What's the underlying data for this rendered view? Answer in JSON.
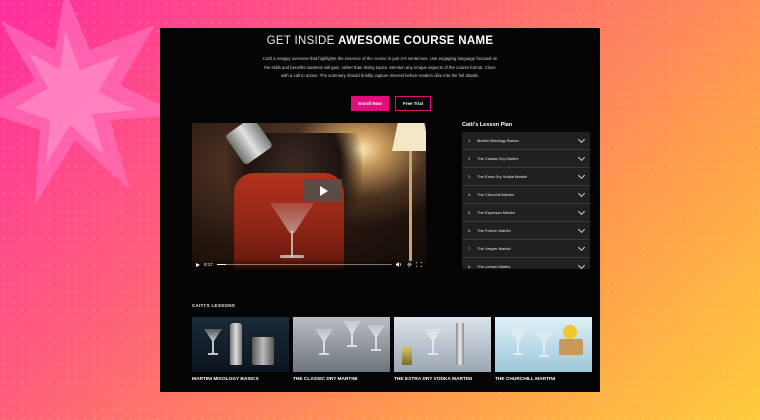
{
  "hero": {
    "title_prefix": "GET INSIDE",
    "title_strong": "AWESOME COURSE NAME",
    "description": "Craft a snappy overview that highlights the essence of the course in just 3-5 sentences. Use engaging language focused on the skills and benefits students will gain, rather than listing topics. Mention any unique aspects of the course format. Close with a call to action. The summary should briskly capture interest before readers dive into the full details.",
    "enroll_label": "Enroll Now",
    "trial_label": "Free Trial"
  },
  "video": {
    "timestamp": "0:17",
    "progress": 0.05
  },
  "lesson_plan": {
    "title": "Caiti's Lesson Plan",
    "items": [
      {
        "num": "1.",
        "name": "Martini Mixology Basics"
      },
      {
        "num": "2.",
        "name": "The Classic Dry Martini"
      },
      {
        "num": "3.",
        "name": "The Extra Dry Vodka Martini"
      },
      {
        "num": "4.",
        "name": "The Churchill Martini"
      },
      {
        "num": "5.",
        "name": "The Espresso Martini"
      },
      {
        "num": "6.",
        "name": "The French Martini"
      },
      {
        "num": "7.",
        "name": "The Vesper Martini"
      },
      {
        "num": "8.",
        "name": "The Lemon Martini"
      }
    ]
  },
  "lessons": {
    "label": "CAITI'S LESSONS",
    "cards": [
      {
        "caption": "MARTINI MIXOLOGY BASICS"
      },
      {
        "caption": "THE CLASSIC DRY MARTINI"
      },
      {
        "caption": "THE EXTRA DRY VODKA MARTINI"
      },
      {
        "caption": "THE CHURCHILL MARTINI"
      }
    ]
  },
  "colors": {
    "accent": "#e40b7d",
    "card_bg": "#050505",
    "list_bg": "#202020"
  },
  "icons": {
    "play": "play-icon",
    "chevron": "chevron-down-icon",
    "volume": "volume-icon",
    "settings": "gear-icon",
    "fullscreen": "fullscreen-icon"
  }
}
